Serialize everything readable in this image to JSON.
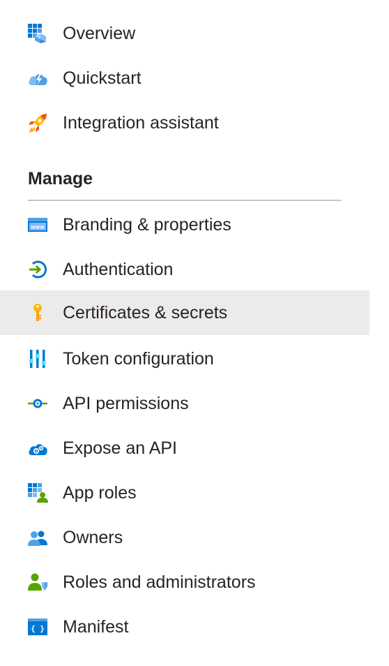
{
  "nav": {
    "top_items": [
      {
        "label": "Overview",
        "icon": "overview-icon"
      },
      {
        "label": "Quickstart",
        "icon": "quickstart-icon"
      },
      {
        "label": "Integration assistant",
        "icon": "rocket-icon"
      }
    ],
    "manage_section": {
      "title": "Manage",
      "items": [
        {
          "label": "Branding & properties",
          "icon": "branding-icon"
        },
        {
          "label": "Authentication",
          "icon": "authentication-icon"
        },
        {
          "label": "Certificates & secrets",
          "icon": "key-icon",
          "selected": true
        },
        {
          "label": "Token configuration",
          "icon": "token-configuration-icon"
        },
        {
          "label": "API permissions",
          "icon": "api-permissions-icon"
        },
        {
          "label": "Expose an API",
          "icon": "cloud-gear-icon"
        },
        {
          "label": "App roles",
          "icon": "app-roles-icon"
        },
        {
          "label": "Owners",
          "icon": "owners-icon"
        },
        {
          "label": "Roles and administrators",
          "icon": "roles-admin-icon"
        },
        {
          "label": "Manifest",
          "icon": "manifest-icon"
        }
      ]
    }
  },
  "colors": {
    "selected_background": "#edebe9",
    "text": "#252423",
    "divider": "#c8c6c4",
    "azure_blue": "#0078d4"
  }
}
